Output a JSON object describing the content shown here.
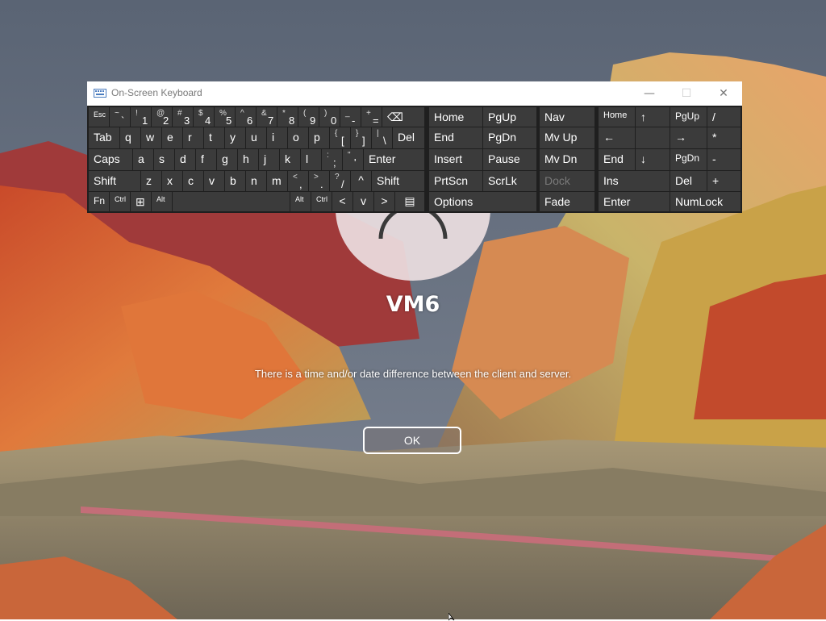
{
  "lockscreen": {
    "username": "VM6",
    "message": "There is a time and/or date difference between the client and server.",
    "ok_label": "OK"
  },
  "osk": {
    "title": "On-Screen Keyboard",
    "controls": {
      "minimize": "—",
      "maximize": "☐",
      "close": "✕"
    },
    "keys": {
      "esc": "Esc",
      "tilde_shift": "~",
      "tilde": "`",
      "n1s": "!",
      "n1": "1",
      "n2s": "@",
      "n2": "2",
      "n3s": "#",
      "n3": "3",
      "n4s": "$",
      "n4": "4",
      "n5s": "%",
      "n5": "5",
      "n6s": "^",
      "n6": "6",
      "n7s": "&",
      "n7": "7",
      "n8s": "*",
      "n8": "8",
      "n9s": "(",
      "n9": "9",
      "n0s": ")",
      "n0": "0",
      "minus_s": "_",
      "minus": "-",
      "eq_s": "+",
      "eq": "=",
      "backspace": "⌫",
      "tab": "Tab",
      "q": "q",
      "w": "w",
      "e": "e",
      "r": "r",
      "t": "t",
      "y": "y",
      "u": "u",
      "i": "i",
      "o": "o",
      "p": "p",
      "lb_s": "{",
      "lb": "[",
      "rb_s": "}",
      "rb": "]",
      "bs_s": "|",
      "bs": "\\",
      "del": "Del",
      "caps": "Caps",
      "a": "a",
      "s": "s",
      "d": "d",
      "f": "f",
      "g": "g",
      "h": "h",
      "j": "j",
      "k": "k",
      "l": "l",
      "sc_s": ":",
      "sc": ";",
      "qt_s": "\"",
      "qt": "'",
      "enter": "Enter",
      "shift": "Shift",
      "z": "z",
      "x": "x",
      "c": "c",
      "v": "v",
      "b": "b",
      "n": "n",
      "m": "m",
      "cm_s": "<",
      "cm": ",",
      "pd_s": ">",
      "pd": ".",
      "sl_s": "?",
      "sl": "/",
      "up": "^",
      "shift_r": "Shift",
      "fn": "Fn",
      "ctrl": "Ctrl",
      "win": "⊞",
      "alt": "Alt",
      "alt_r": "Alt",
      "ctrl_r": "Ctrl",
      "left": "<",
      "down": "v",
      "right": ">",
      "menu": "▤",
      "home": "Home",
      "pgup": "PgUp",
      "end": "End",
      "pgdn": "PgDn",
      "insert": "Insert",
      "pause": "Pause",
      "prtscn": "PrtScn",
      "scrlk": "ScrLk",
      "options": "Options",
      "nav": "Nav",
      "mvup": "Mv Up",
      "mvdn": "Mv Dn",
      "dock": "Dock",
      "fade": "Fade",
      "np_home": "Home",
      "np_up": "↑",
      "np_pgup": "PgUp",
      "np_div": "/",
      "np_left": "←",
      "np_right": "→",
      "np_mul": "*",
      "np_end": "End",
      "np_down": "↓",
      "np_pgdn": "PgDn",
      "np_minus": "-",
      "np_ins": "Ins",
      "np_del": "Del",
      "np_plus": "+",
      "np_enter": "Enter",
      "numlock": "NumLock"
    }
  },
  "colors": {
    "key_bg": "#3b3b3b",
    "osk_bg": "#1f1f1f",
    "dim_text": "#7a7a7a"
  }
}
